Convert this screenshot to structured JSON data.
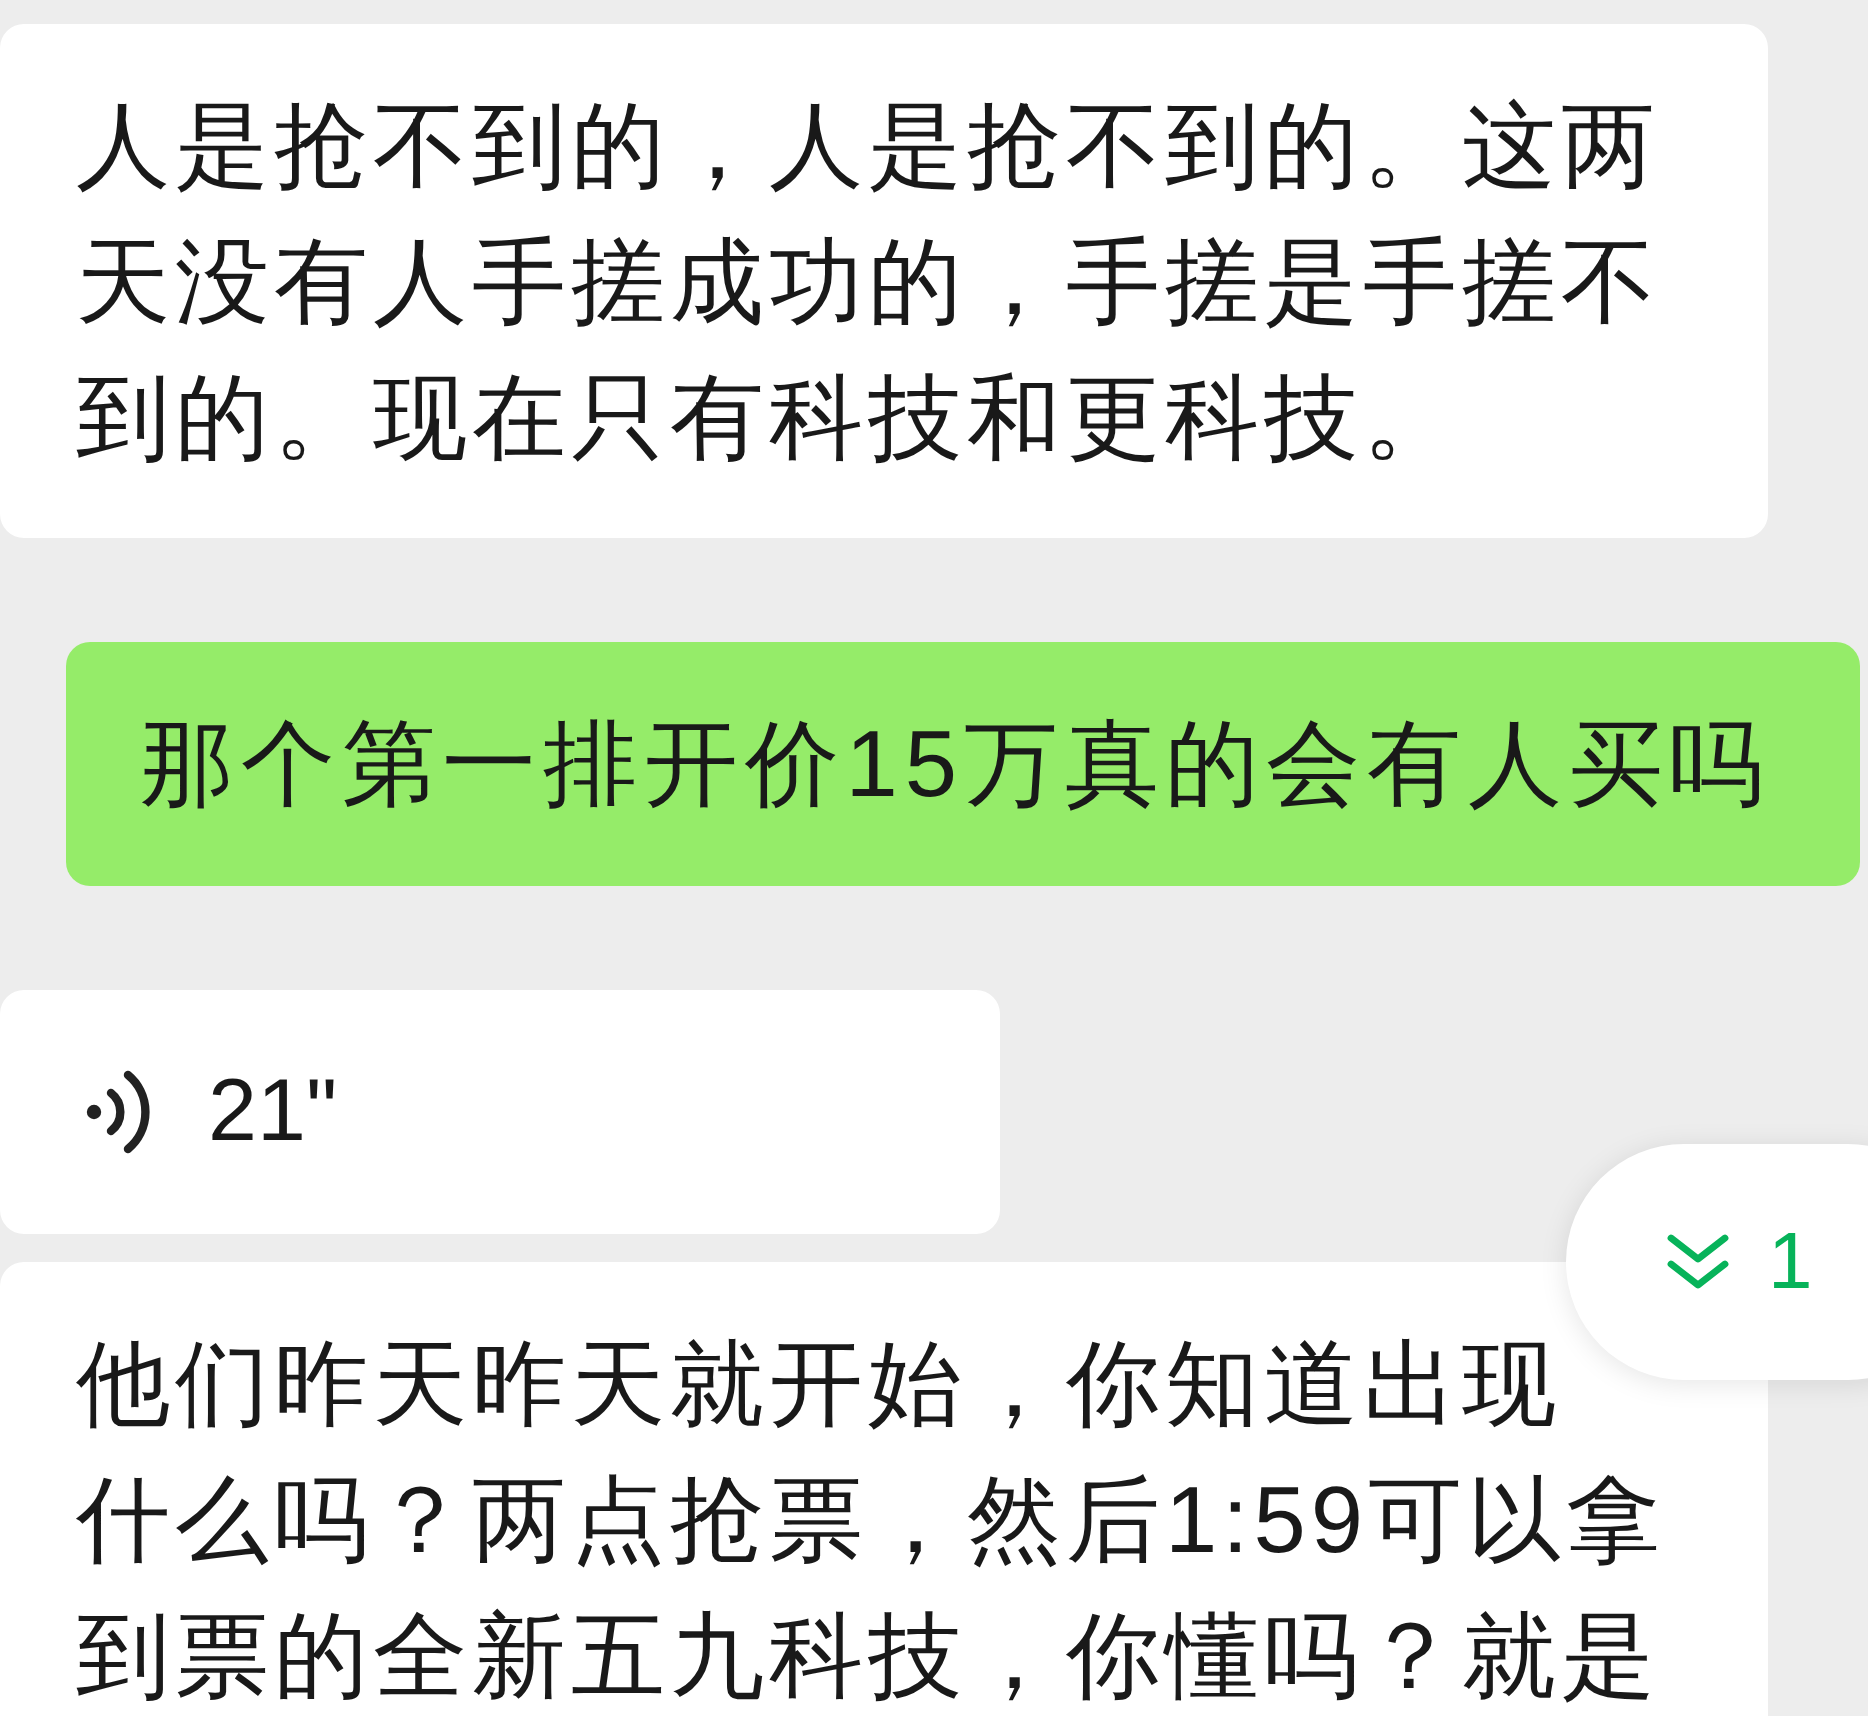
{
  "messages": [
    {
      "kind": "text",
      "outgoing": false,
      "lines": [
        "人是抢不到的，人是抢不到的。这两",
        "天没有人手搓成功的，手搓是手搓不",
        "到的。现在只有科技和更科技。"
      ]
    },
    {
      "kind": "text",
      "outgoing": true,
      "lines": [
        "那个第一排开价15万真的会有人买吗"
      ]
    },
    {
      "kind": "voice",
      "outgoing": false,
      "duration": "21\""
    },
    {
      "kind": "text",
      "outgoing": false,
      "lines": [
        "他们昨天昨天就开始，你知道出现",
        "什么吗？两点抢票，然后1:59可以拿",
        "到票的全新五九科技，你懂吗？就是"
      ]
    }
  ],
  "new_messages_button": {
    "label": "1"
  }
}
